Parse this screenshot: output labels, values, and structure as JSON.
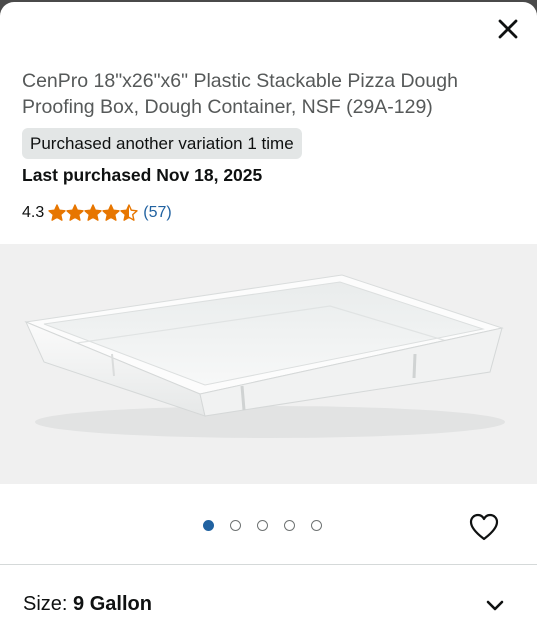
{
  "modal": {
    "close_label": "×",
    "product_title": "CenPro 18\"x26\"x6\" Plastic Stackable Pizza Dough Proofing Box, Dough Container, NSF (29A-129)",
    "purchase_badge": "Purchased another variation 1 time",
    "last_purchased": "Last purchased Nov 18, 2025",
    "rating": {
      "value": "4.3",
      "stars_filled": 4.3,
      "stars_total": 5,
      "review_count": "(57)",
      "star_color": "#e77600"
    },
    "image": {
      "alt_icon": "dough-proofing-box-image",
      "carousel_count": 5,
      "carousel_active_index": 0
    },
    "wishlist_icon": "heart-icon",
    "size": {
      "label": "Size:",
      "value": "9 Gallon",
      "icon": "chevron-down-icon"
    }
  },
  "colors": {
    "link": "#2162a1",
    "badge_bg": "#e3e6e6",
    "title_gray": "#565959",
    "star": "#e77600"
  }
}
